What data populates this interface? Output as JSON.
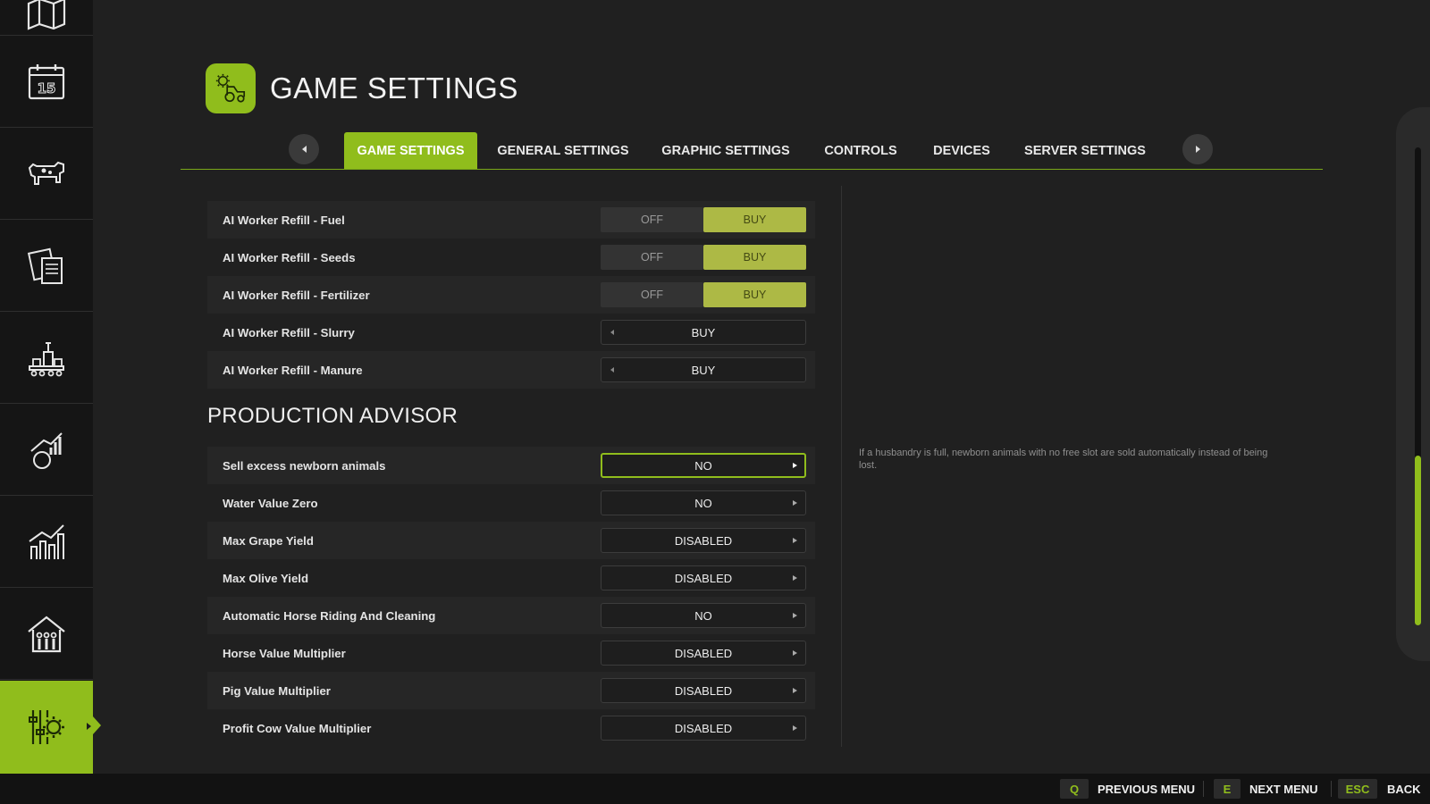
{
  "header": {
    "title": "GAME SETTINGS",
    "icon": "tractor-gear-icon"
  },
  "sidebar": {
    "items": [
      {
        "icon": "map-icon",
        "active": false
      },
      {
        "icon": "calendar-icon",
        "label": "15",
        "active": false
      },
      {
        "icon": "cow-icon",
        "active": false
      },
      {
        "icon": "contracts-icon",
        "active": false
      },
      {
        "icon": "production-icon",
        "active": false
      },
      {
        "icon": "prices-icon",
        "active": false
      },
      {
        "icon": "statistics-icon",
        "active": false
      },
      {
        "icon": "husbandry-icon",
        "active": false
      },
      {
        "icon": "settings-icon",
        "active": true
      }
    ]
  },
  "tabs": [
    {
      "label": "GAME SETTINGS",
      "active": true
    },
    {
      "label": "GENERAL SETTINGS"
    },
    {
      "label": "GRAPHIC SETTINGS"
    },
    {
      "label": "CONTROLS"
    },
    {
      "label": "DEVICES"
    },
    {
      "label": "SERVER SETTINGS"
    }
  ],
  "settings": [
    {
      "label": "AI Worker Refill - Fuel",
      "type": "toggle",
      "options": [
        "OFF",
        "BUY"
      ],
      "selected": "BUY"
    },
    {
      "label": "AI Worker Refill - Seeds",
      "type": "toggle",
      "options": [
        "OFF",
        "BUY"
      ],
      "selected": "BUY"
    },
    {
      "label": "AI Worker Refill - Fertilizer",
      "type": "toggle",
      "options": [
        "OFF",
        "BUY"
      ],
      "selected": "BUY"
    },
    {
      "label": "AI Worker Refill - Slurry",
      "type": "select",
      "value": "BUY"
    },
    {
      "label": "AI Worker Refill - Manure",
      "type": "select",
      "value": "BUY"
    }
  ],
  "production_advisor": {
    "title": "PRODUCTION ADVISOR",
    "items": [
      {
        "label": "Sell excess newborn animals",
        "value": "NO",
        "focused": true
      },
      {
        "label": "Water Value Zero",
        "value": "NO"
      },
      {
        "label": "Max Grape Yield",
        "value": "DISABLED"
      },
      {
        "label": "Max Olive Yield",
        "value": "DISABLED"
      },
      {
        "label": "Automatic Horse Riding And Cleaning",
        "value": "NO"
      },
      {
        "label": "Horse Value Multiplier",
        "value": "DISABLED"
      },
      {
        "label": "Pig Value Multiplier",
        "value": "DISABLED"
      },
      {
        "label": "Profit Cow Value Multiplier",
        "value": "DISABLED"
      }
    ]
  },
  "help_text": "If a husbandry is full, newborn animals with no free slot are sold automatically instead of being lost.",
  "footer": {
    "actions": [
      {
        "key": "Q",
        "label": "PREVIOUS MENU"
      },
      {
        "key": "E",
        "label": "NEXT MENU"
      },
      {
        "key": "ESC",
        "label": "BACK"
      }
    ]
  },
  "colors": {
    "accent": "#90bd1c",
    "toggle_on": "#adb945",
    "background": "#202020",
    "sidebar": "#151515"
  }
}
